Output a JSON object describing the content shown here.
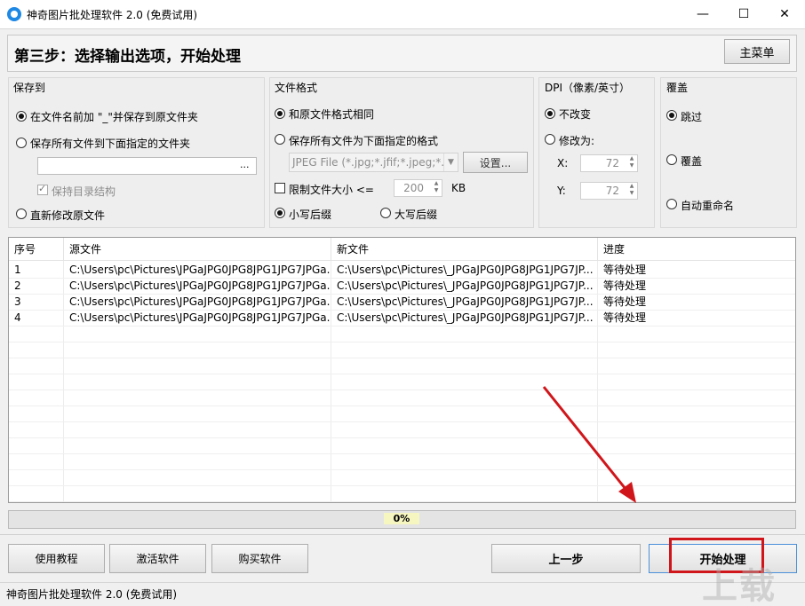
{
  "window": {
    "title": "神奇图片批处理软件 2.0 (免费试用)",
    "minimize": "—",
    "maximize": "☐",
    "close": "✕"
  },
  "step": {
    "title": "第三步：选择输出选项，开始处理",
    "menu_button": "主菜单"
  },
  "save_to": {
    "label": "保存到",
    "opt_prefix": "在文件名前加 \"_\"并保存到原文件夹",
    "opt_folder": "保存所有文件到下面指定的文件夹",
    "folder_value": "",
    "browse": "...",
    "keep_structure": "保持目录结构",
    "opt_overwrite": "直新修改原文件"
  },
  "format": {
    "label": "文件格式",
    "opt_same": "和原文件格式相同",
    "opt_specified": "保存所有文件为下面指定的格式",
    "format_value": "JPEG File (*.jpg;*.jfif;*.jpeg;*.j",
    "settings": "设置...",
    "limit_size": "限制文件大小 <=",
    "limit_value": "200",
    "limit_unit": "KB",
    "lower_ext": "小写后缀",
    "upper_ext": "大写后缀"
  },
  "dpi": {
    "label": "DPI（像素/英寸）",
    "opt_keep": "不改变",
    "opt_change": "修改为:",
    "x_label": "X:",
    "x_value": "72",
    "y_label": "Y:",
    "y_value": "72"
  },
  "overwrite": {
    "label": "覆盖",
    "opt_skip": "跳过",
    "opt_cover": "覆盖",
    "opt_rename": "自动重命名"
  },
  "table": {
    "headers": [
      "序号",
      "源文件",
      "新文件",
      "进度"
    ],
    "rows": [
      [
        "1",
        "C:\\Users\\pc\\Pictures\\JPGaJPG0JPG8JPG1JPG7JPGa...",
        "C:\\Users\\pc\\Pictures\\_JPGaJPG0JPG8JPG1JPG7JP...",
        "等待处理"
      ],
      [
        "2",
        "C:\\Users\\pc\\Pictures\\JPGaJPG0JPG8JPG1JPG7JPGa...",
        "C:\\Users\\pc\\Pictures\\_JPGaJPG0JPG8JPG1JPG7JP...",
        "等待处理"
      ],
      [
        "3",
        "C:\\Users\\pc\\Pictures\\JPGaJPG0JPG8JPG1JPG7JPGa...",
        "C:\\Users\\pc\\Pictures\\_JPGaJPG0JPG8JPG1JPG7JP...",
        "等待处理"
      ],
      [
        "4",
        "C:\\Users\\pc\\Pictures\\JPGaJPG0JPG8JPG1JPG7JPGa...",
        "C:\\Users\\pc\\Pictures\\_JPGaJPG0JPG8JPG1JPG7JP...",
        "等待处理"
      ]
    ]
  },
  "progress": {
    "text": "0%",
    "value": 0
  },
  "buttons": {
    "tutorial": "使用教程",
    "activate": "激活软件",
    "buy": "购买软件",
    "prev": "上一步",
    "start": "开始处理"
  },
  "status": {
    "text": "神奇图片批处理软件 2.0 (免费试用)"
  },
  "watermark": "上载",
  "colors": {
    "highlight": "#d0161b",
    "app_icon": "#1e88e5"
  }
}
